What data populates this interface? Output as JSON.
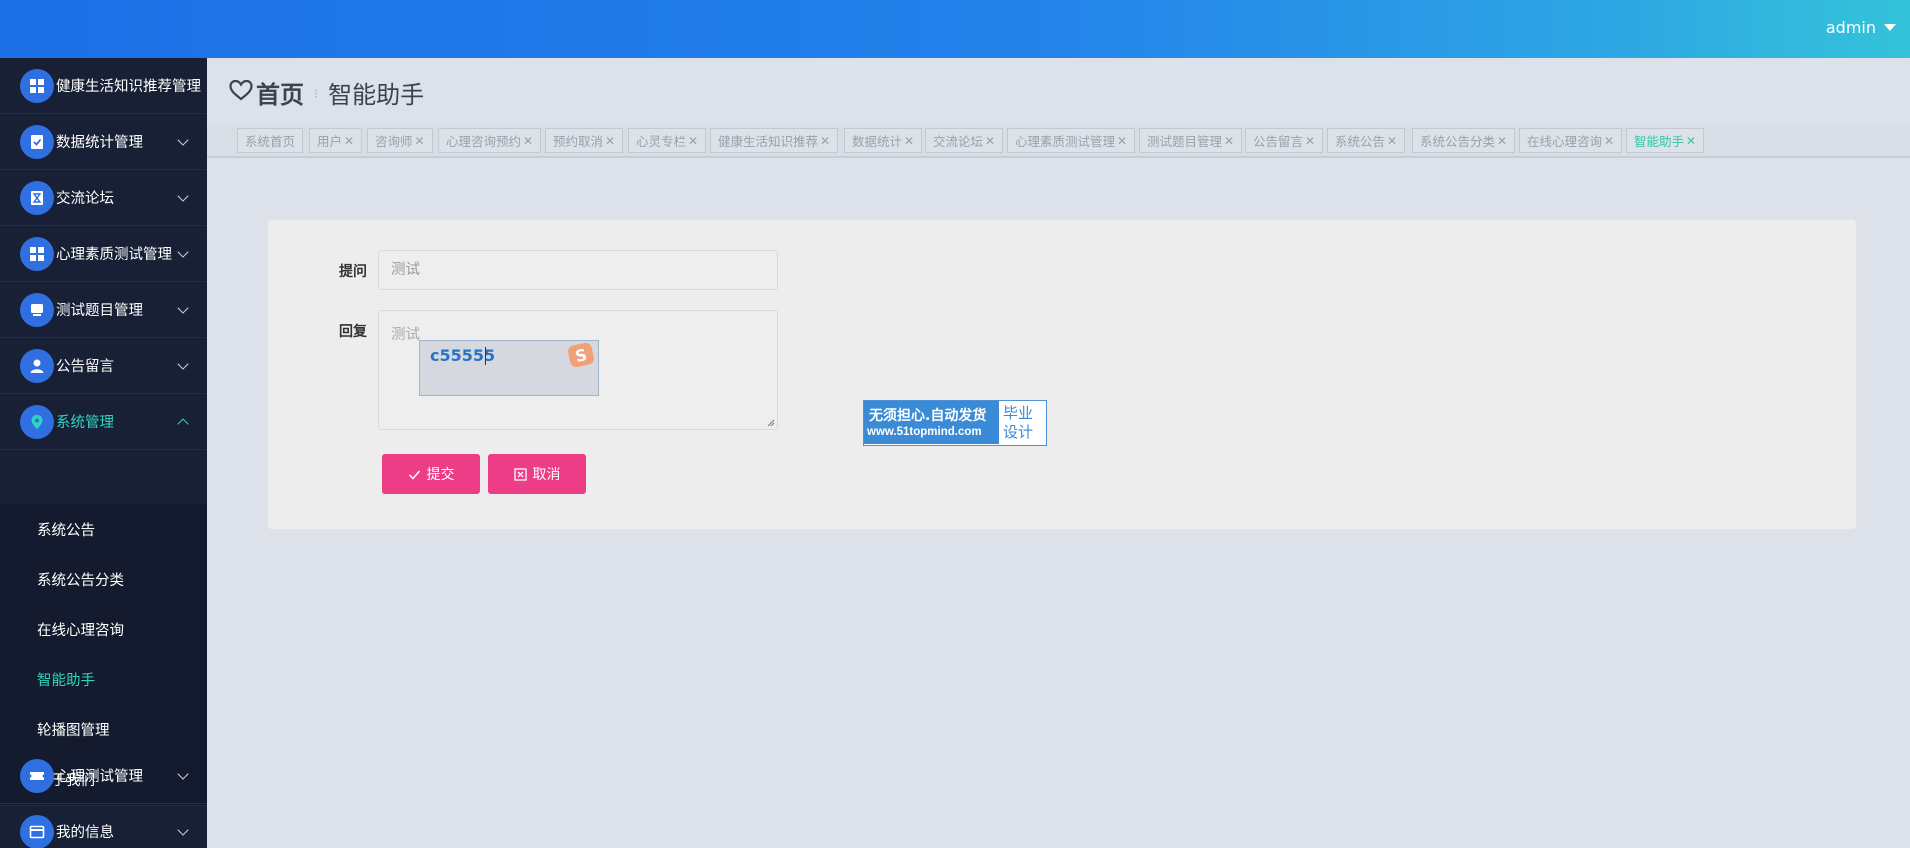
{
  "header": {
    "user": "admin"
  },
  "sidebar": {
    "top_item": "健康生活知识推荐管理",
    "items": [
      {
        "label": "数据统计管理"
      },
      {
        "label": "交流论坛"
      },
      {
        "label": "心理素质测试管理"
      },
      {
        "label": "测试题目管理"
      },
      {
        "label": "公告留言"
      },
      {
        "label": "系统管理"
      }
    ],
    "sub_items": [
      "系统公告",
      "系统公告分类",
      "在线心理咨询",
      "智能助手",
      "轮播图管理",
      "关于我们"
    ],
    "bottom_items": [
      {
        "label": "心理测试管理"
      },
      {
        "label": "我的信息"
      }
    ]
  },
  "breadcrumb": {
    "home": "首页",
    "current": "智能助手"
  },
  "tabs": [
    "系统首页",
    "用户",
    "咨询师",
    "心理咨询预约",
    "预约取消",
    "心灵专栏",
    "健康生活知识推荐",
    "数据统计",
    "交流论坛",
    "心理素质测试管理",
    "测试题目管理",
    "公告留言",
    "系统公告",
    "系统公告分类",
    "在线心理咨询",
    "智能助手"
  ],
  "form": {
    "question_label": "提问",
    "question_value": "测试",
    "reply_label": "回复",
    "reply_value": "测试",
    "ime_text": "c55555",
    "submit_label": "提交",
    "cancel_label": "取消"
  },
  "watermark": {
    "line1": "无须担心.自动发货",
    "line2": "www.51topmind.com",
    "side1": "毕业",
    "side2": "设计"
  },
  "colors": {
    "accent": "#2fd4c0",
    "button": "#ec3d86",
    "sidebar_bg": "#182036",
    "header_start": "#1c6fe6",
    "header_end": "#34c3da"
  }
}
